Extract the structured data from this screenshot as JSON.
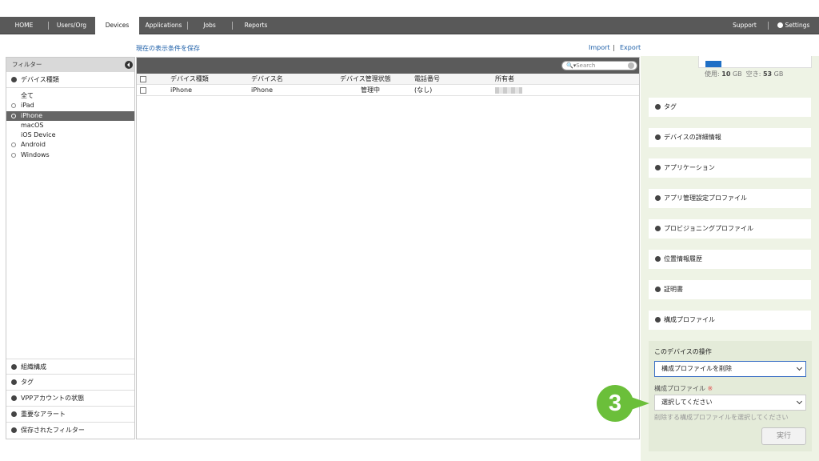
{
  "nav": {
    "tabs": [
      {
        "label": "HOME"
      },
      {
        "label": "Users/Org"
      },
      {
        "label": "Devices"
      },
      {
        "label": "Applications"
      },
      {
        "label": "Jobs"
      },
      {
        "label": "Reports"
      }
    ],
    "active_tab": "Devices",
    "support": "Support",
    "settings": "Settings"
  },
  "links": {
    "save_conditions": "現在の表示条件を保存",
    "import": "Import",
    "separator": "|",
    "export": "Export"
  },
  "filter": {
    "title": "フィルター",
    "device_type_section": "デバイス種類",
    "items": [
      {
        "label": "全て",
        "expandable": false,
        "selected": false
      },
      {
        "label": "iPad",
        "expandable": true,
        "selected": false
      },
      {
        "label": "iPhone",
        "expandable": true,
        "selected": true
      },
      {
        "label": "macOS",
        "expandable": false,
        "selected": false
      },
      {
        "label": "iOS Device",
        "expandable": false,
        "selected": false
      },
      {
        "label": "Android",
        "expandable": true,
        "selected": false
      },
      {
        "label": "Windows",
        "expandable": true,
        "selected": false
      }
    ],
    "bottom_sections": [
      "組織構成",
      "タグ",
      "VPPアカウントの状態",
      "重要なアラート",
      "保存されたフィルター"
    ]
  },
  "search": {
    "placeholder": "Search"
  },
  "table": {
    "columns": [
      "デバイス種類",
      "デバイス名",
      "デバイス管理状態",
      "電話番号",
      "所有者"
    ],
    "rows": [
      {
        "type": "iPhone",
        "name": "iPhone",
        "status": "管理中",
        "phone": "(なし)"
      }
    ]
  },
  "storage": {
    "used_label": "使用:",
    "used_value": "10",
    "used_unit": "GB",
    "free_label": "空き:",
    "free_value": "53",
    "free_unit": "GB",
    "used_fraction": 0.16
  },
  "right_sections": [
    "タグ",
    "デバイスの詳細情報",
    "アプリケーション",
    "アプリ管理設定プロファイル",
    "プロビジョニングプロファイル",
    "位置情報履歴",
    "証明書",
    "構成プロファイル"
  ],
  "operations": {
    "title": "このデバイスの操作",
    "action_value": "構成プロファイルを削除",
    "profile_label": "構成プロファイル",
    "required_mark": "※",
    "profile_placeholder": "選択してください",
    "hint": "削除する構成プロファイルを選択してください",
    "run_button": "実行"
  },
  "step_marker": "3",
  "colors": {
    "nav_bg": "#595959",
    "link": "#1d5fa8",
    "right_pane_bg": "#eef3e5",
    "marker": "#6bbf3a",
    "storage_bar": "#1f6fc5"
  }
}
